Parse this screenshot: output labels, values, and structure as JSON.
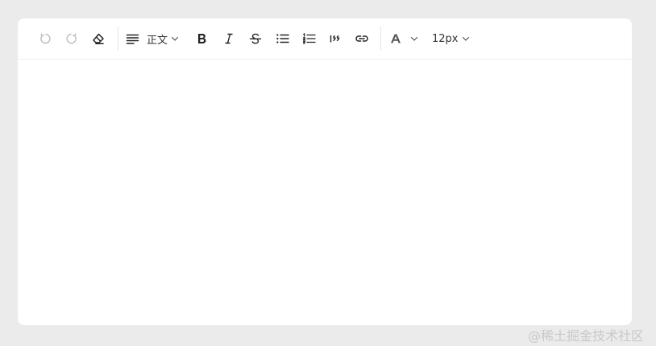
{
  "toolbar": {
    "paragraph_style": "正文",
    "font_size": "12px"
  },
  "editor": {
    "content": ""
  },
  "watermark": "@稀土掘金技术社区"
}
